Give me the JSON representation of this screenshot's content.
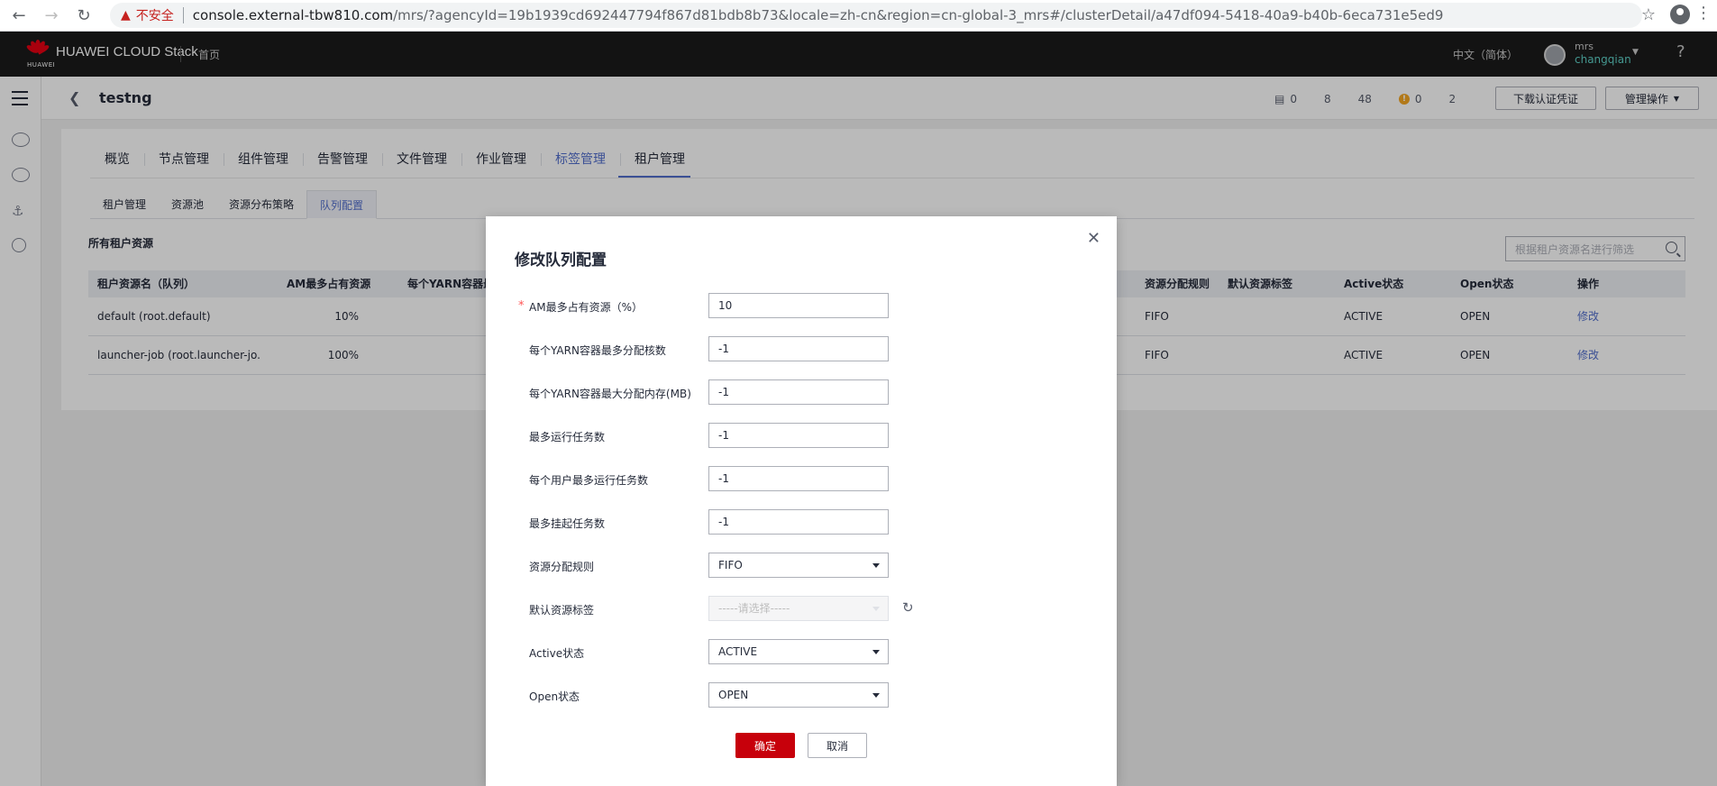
{
  "browser": {
    "insecure_label": "不安全",
    "url_host": "console.external-tbw810.com",
    "url_path": "/mrs/?agencyId=19b1939cd692447794f867d81bdb8b73&locale=zh-cn&region=cn-global-3_mrs#/clusterDetail/a47df094-5418-40a9-b40b-6eca731e5ed9"
  },
  "header": {
    "brand": "HUAWEI CLOUD Stack",
    "brand_small": "HUAWEI",
    "home": "首页",
    "language": "中文（简体）",
    "user_account": "mrs",
    "user_name": "changqian"
  },
  "page": {
    "title": "testng",
    "stats": [
      "0",
      "8",
      "48",
      "0",
      "2"
    ],
    "download_button": "下载认证凭证",
    "manage_button": "管理操作"
  },
  "tabs": [
    "概览",
    "节点管理",
    "组件管理",
    "告警管理",
    "文件管理",
    "作业管理",
    "标签管理",
    "租户管理"
  ],
  "active_tab": "标签管理",
  "subtabs": [
    "租户管理",
    "资源池",
    "资源分布策略",
    "队列配置"
  ],
  "active_subtab": "队列配置",
  "section": {
    "title": "所有租户资源",
    "filter_placeholder": "根据租户资源名进行筛选"
  },
  "table": {
    "headers": [
      "租户资源名（队列）",
      "AM最多占有资源",
      "每个YARN容器最",
      "资源分配规则",
      "默认资源标签",
      "Active状态",
      "Open状态",
      "操作"
    ],
    "rows": [
      {
        "name": "default (root.default)",
        "am": "10%",
        "rule": "FIFO",
        "label": "",
        "active": "ACTIVE",
        "open": "OPEN",
        "action": "修改"
      },
      {
        "name": "launcher-job (root.launcher-jo...",
        "am": "100%",
        "rule": "FIFO",
        "label": "",
        "active": "ACTIVE",
        "open": "OPEN",
        "action": "修改"
      }
    ]
  },
  "dialog": {
    "title": "修改队列配置",
    "fields": [
      {
        "label": "AM最多占有资源（%）",
        "value": "10",
        "required": true
      },
      {
        "label": "每个YARN容器最多分配核数",
        "value": "-1"
      },
      {
        "label": "每个YARN容器最大分配内存(MB)",
        "value": "-1"
      },
      {
        "label": "最多运行任务数",
        "value": "-1"
      },
      {
        "label": "每个用户最多运行任务数",
        "value": "-1"
      },
      {
        "label": "最多挂起任务数",
        "value": "-1"
      },
      {
        "label": "资源分配规则",
        "value": "FIFO"
      },
      {
        "label": "默认资源标签",
        "placeholder": "-----请选择-----"
      },
      {
        "label": "Active状态",
        "value": "ACTIVE"
      },
      {
        "label": "Open状态",
        "value": "OPEN"
      }
    ],
    "confirm": "确定",
    "cancel": "取消"
  },
  "colors": {
    "primary_red": "#c7000b",
    "link_blue": "#526ecc",
    "header_bg": "#1b1b1b"
  }
}
